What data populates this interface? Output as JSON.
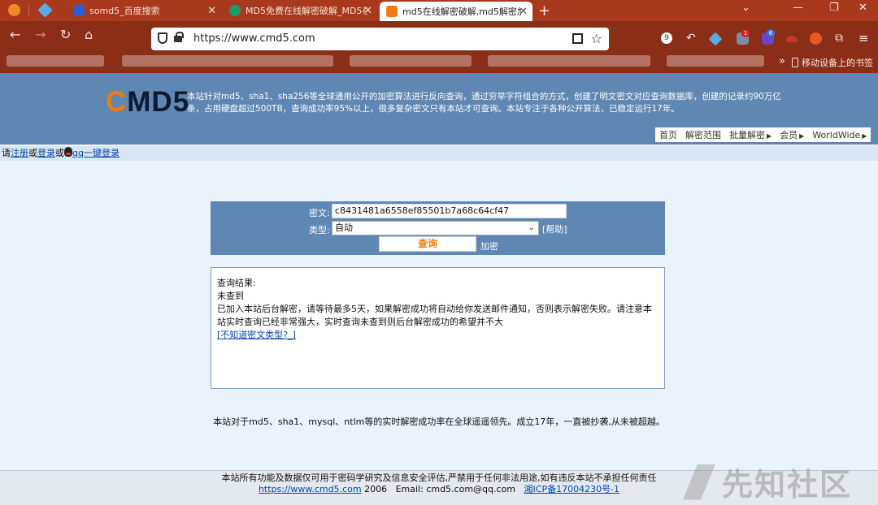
{
  "browser": {
    "tabs": [
      {
        "label": "somd5_百度搜索",
        "icon_color": "#2f5bd6",
        "active": false
      },
      {
        "label": "MD5免费在线解密破解_MD5在",
        "icon_color": "#1c9b6a",
        "active": false
      },
      {
        "label": "md5在线解密破解,md5解密加",
        "icon_color": "#f07c11",
        "active": true
      }
    ],
    "url": "https://www.cmd5.com",
    "bookmarks_right": "移动设备上的书签",
    "ext_badges": [
      "9",
      "1",
      "6"
    ]
  },
  "site": {
    "logo_c": "C",
    "logo_rest": "MD5",
    "intro": "本站针对md5、sha1、sha256等全球通用公开的加密算法进行反向查询，通过穷举字符组合的方式，创建了明文密文对应查询数据库，创建的记录约90万亿条，占用硬盘超过500TB，查询成功率95%以上，很多复杂密文只有本站才可查询。本站专注于各种公开算法，已稳定运行17年。",
    "nav": [
      "首页",
      "解密范围",
      "批量解密",
      "会员",
      "WorldWide"
    ],
    "login": {
      "prefix": "请",
      "register": "注册",
      "or1": "或",
      "login": "登录",
      "or2": "或",
      "qq": "qq一键登录"
    }
  },
  "form": {
    "cipher_label": "密文:",
    "cipher_value": "c8431481a6558ef85501b7a68c64cf47",
    "type_label": "类型:",
    "type_value": "自动",
    "help": "[帮助]",
    "query_button": "查询",
    "encrypt_link": "加密"
  },
  "result": {
    "title": "查询结果:",
    "status": "未查到",
    "message": "已加入本站后台解密，请等待最多5天，如果解密成功将自动给你发送邮件通知，否则表示解密失败。请注意本站实时查询已经非常强大，实时查询未查到则后台解密成功的希望并不大",
    "link": "[不知道密文类型?_]"
  },
  "claim": "本站对于md5、sha1、mysql、ntlm等的实时解密成功率在全球遥遥领先。成立17年，一直被抄袭,从未被超越。",
  "footer": {
    "disclaimer": "本站所有功能及数据仅可用于密码学研究及信息安全评估,严禁用于任何非法用途,如有违反本站不承担任何责任",
    "site_link": "https://www.cmd5.com",
    "year": "2006",
    "email": "Email: cmd5.com@qq.com",
    "icp": "湘ICP备17004230号-1"
  },
  "watermark": "先知社区"
}
